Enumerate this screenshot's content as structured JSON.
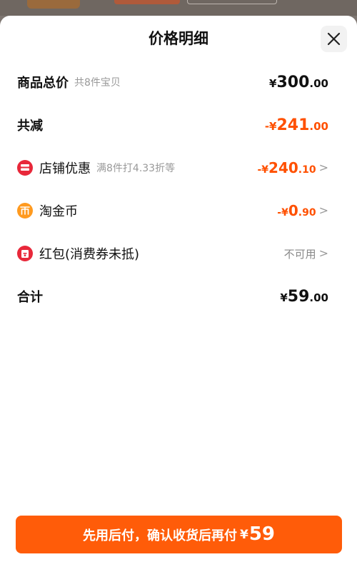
{
  "header": {
    "title": "价格明细"
  },
  "rows": {
    "goods_total": {
      "label": "商品总价",
      "sub": "共8件宝贝",
      "currency": "¥",
      "int": "300",
      "dec": ".00"
    },
    "total_reduce": {
      "label": "共减",
      "prefix": "-",
      "currency": "¥",
      "int": "241",
      "dec": ".00"
    },
    "store_discount": {
      "label": "店铺优惠",
      "sub": "满8件打4.33折等",
      "prefix": "-",
      "currency": "¥",
      "int": "240",
      "dec": ".10",
      "chevron": ">"
    },
    "tao_coin": {
      "label": "淘金币",
      "prefix": "-",
      "currency": "¥",
      "int": "0",
      "dec": ".90",
      "chevron": ">"
    },
    "red_packet": {
      "label": "红包(消费券未抵)",
      "status": "不可用",
      "chevron": ">"
    },
    "total": {
      "label": "合计",
      "currency": "¥",
      "int": "59",
      "dec": ".00"
    }
  },
  "footer": {
    "button_text": "先用后付，确认收货后再付",
    "currency": "¥",
    "amount": "59"
  },
  "icons": {
    "close": "close-icon",
    "store": "store-icon",
    "coin": "coin-icon",
    "red_packet": "red-packet-icon"
  },
  "colors": {
    "accent": "#ff5000",
    "button": "#ff5c09",
    "store_icon": "#e8283a",
    "coin_icon": "#ff9a1f"
  }
}
